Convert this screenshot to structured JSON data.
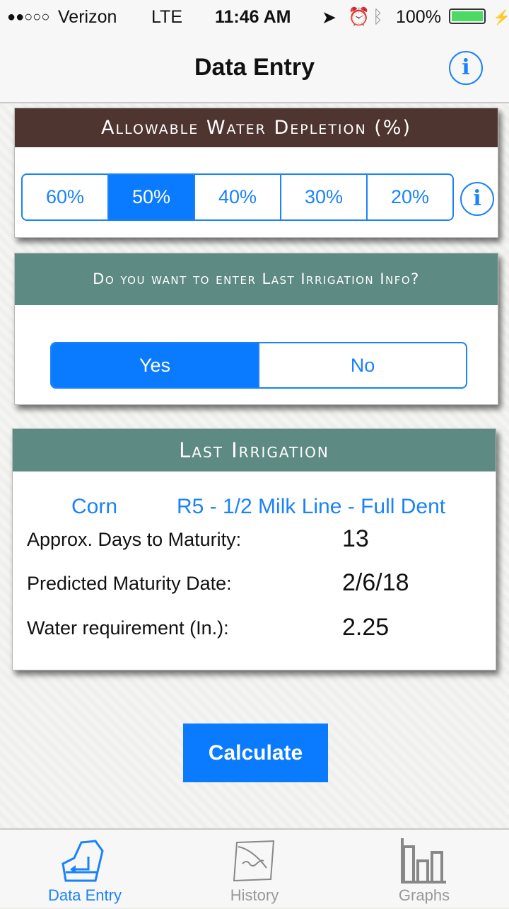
{
  "status_bar": {
    "signal": "●●○○○",
    "carrier": "Verizon",
    "network": "LTE",
    "time": "11:46 AM",
    "battery": "100%",
    "battery_color": "#4cd964"
  },
  "nav": {
    "title": "Data Entry",
    "info_icon": "info-icon",
    "info_label": "i"
  },
  "depletion": {
    "title": "Allowable Water Depletion (%)",
    "header_color": "#4e3530",
    "options": [
      "60%",
      "50%",
      "40%",
      "30%",
      "20%"
    ],
    "selected": "50%",
    "info_label": "i"
  },
  "last_irrigation_prompt": {
    "title": "Do you want to enter Last Irrigation Info?",
    "header_color": "#5d8a83",
    "options": [
      "Yes",
      "No"
    ],
    "selected": "Yes"
  },
  "last_irrigation": {
    "title": "Last Irrigation",
    "crop": "Corn",
    "stage": "R5 - 1/2 Milk Line - Full Dent",
    "rows": [
      {
        "label": "Approx. Days to Maturity:",
        "value": "13"
      },
      {
        "label": "Predicted Maturity Date:",
        "value": "2/6/18"
      },
      {
        "label": "Water requirement (In.):",
        "value": "2.25"
      }
    ]
  },
  "calculate_label": "Calculate",
  "accent": "#0a7aff",
  "tabs": [
    {
      "label": "Data Entry",
      "icon": "data-entry-icon",
      "active": true
    },
    {
      "label": "History",
      "icon": "scroll-icon",
      "active": false
    },
    {
      "label": "Graphs",
      "icon": "bar-chart-icon",
      "active": false
    }
  ]
}
